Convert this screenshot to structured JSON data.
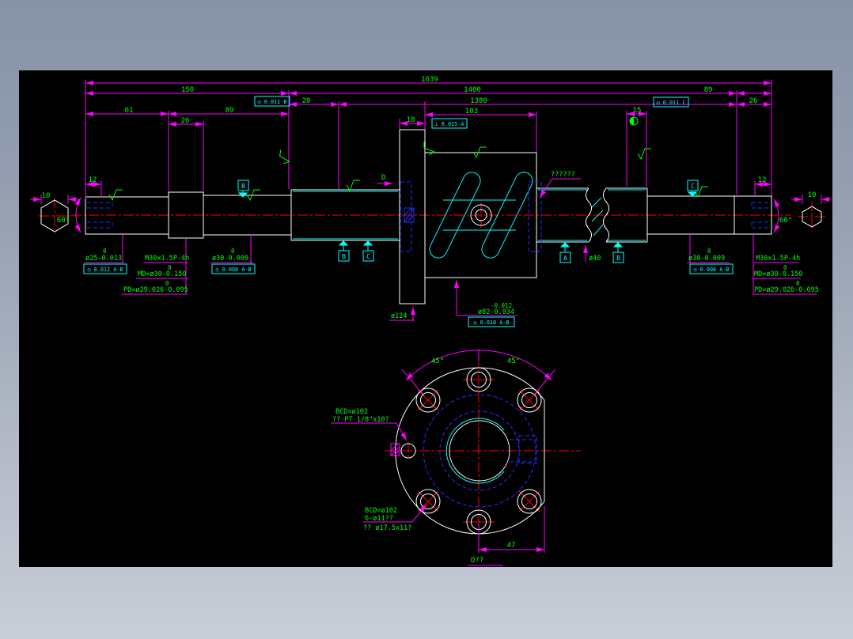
{
  "window": {
    "canvas_color": "#000000",
    "chrome_top_color": "#8792a7",
    "chrome_bottom_color": "#c9cdd7"
  },
  "colors": {
    "dimension": "#ff00ff",
    "text": "#00ff00",
    "geometry": "#ffffff",
    "detail": "#00ffff",
    "hidden": "#2a2aff",
    "centerline": "#ff0000"
  },
  "drawing": {
    "dims": {
      "total": "1639",
      "left_section": "150",
      "screw_span": "1400",
      "thread_len": "1380",
      "end_a": "61",
      "end_b": "89",
      "journal_left": "26",
      "flange_gap": "20",
      "nut_body": "103",
      "flange_width": "18",
      "spacer": "15",
      "right_span": "89",
      "journal_right": "26",
      "wrench_left": "12",
      "wrench_right": "12",
      "hex_left": "10",
      "hex_right": "10",
      "chamfer_left": "60°",
      "chamfer_right": "60°",
      "flange_od": "ø124",
      "screw_od": "ø40",
      "bolt_angle_1": "45°",
      "bolt_angle_2": "45°",
      "flat_offset": "47"
    },
    "callouts": {
      "d25_sup": "0",
      "d25": "ø25-0.013",
      "thread": "M30x1.5P-4h",
      "md_sup": "0",
      "md": "MD=ø30-0.150",
      "pd_sup": "0",
      "pd": "PD=ø29.026-0.095",
      "d30_sup": "0",
      "d30": "ø30-0.009",
      "d82_sup": "-0.012",
      "d82": "ø82-0.034",
      "nut_note": "??????",
      "view_dir": "D",
      "view_label": "D??",
      "bcd_top": "BCD=ø102",
      "port": "?? PT 1/8\"x10?",
      "bcd_bottom": "BCD=ø102",
      "bolt_holes": "6-ø11??",
      "counterbore": "?? ø17.5x11?"
    },
    "fcf": {
      "f20": "◎ 0.011 B",
      "f89": "◎ 0.011 C",
      "f18": "⟂ 0.015 A",
      "f25": "◎ 0.012 A-B",
      "f30_left": "◎ 0.008 A-B",
      "f30_right": "◎ 0.008 A-B",
      "f82": "◎ 0.010 A-B"
    },
    "datums": {
      "a": "A",
      "b": "B",
      "c": "C"
    }
  }
}
